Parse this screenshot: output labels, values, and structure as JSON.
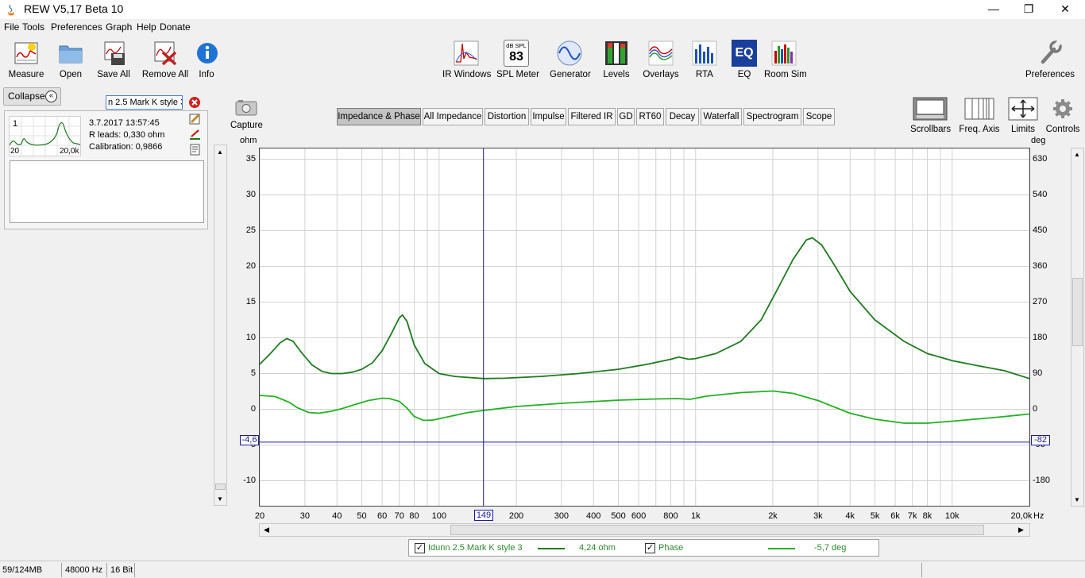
{
  "window": {
    "title": "REW V5,17 Beta 10",
    "minimize": "—",
    "maximize": "❐",
    "close": "✕"
  },
  "menu": [
    "File",
    "Tools",
    "Preferences",
    "Graph",
    "Help",
    "Donate"
  ],
  "toolbar": {
    "measure": "Measure",
    "open": "Open",
    "save_all": "Save All",
    "remove_all": "Remove All",
    "info": "Info",
    "ir_windows": "IR Windows",
    "spl_meter": "SPL Meter",
    "spl_unit": "dB SPL",
    "spl_value": "83",
    "generator": "Generator",
    "levels": "Levels",
    "overlays": "Overlays",
    "rta": "RTA",
    "eq": "EQ",
    "room_sim": "Room Sim",
    "preferences": "Preferences"
  },
  "left_panel": {
    "collapse_label": "Collapse",
    "measurement_name": "n 2.5 Mark K style 3",
    "index": "1",
    "thumb_xmin": "20",
    "thumb_xmax": "20,0k",
    "date": "3.7.2017 13:57:45",
    "r_leads": "R leads: 0,330 ohm",
    "calibration": "Calibration: 0,9866"
  },
  "graph_tabs": [
    "Impedance & Phase",
    "All Impedance",
    "Distortion",
    "Impulse",
    "Filtered IR",
    "GD",
    "RT60",
    "Decay",
    "Waterfall",
    "Spectrogram",
    "Scope"
  ],
  "active_tab": "Impedance & Phase",
  "capture_label": "Capture",
  "right_tools": {
    "scrollbars": "Scrollbars",
    "freq_axis": "Freq. Axis",
    "limits": "Limits",
    "controls": "Controls"
  },
  "colors": {
    "impedance": "#1e7a1e",
    "phase": "#22b022",
    "cursor": "#1a1aa0",
    "grid": "#d2d2d2"
  },
  "cursor": {
    "freq_label": "149",
    "left_value": "-4,6",
    "right_value": "-82"
  },
  "legend": {
    "series1_name": "Idunn 2.5 Mark K style 3",
    "series1_value": "4,24 ohm",
    "series2_name": "Phase",
    "series2_value": "-5,7 deg"
  },
  "status": {
    "memory": "59/124MB",
    "rate": "48000 Hz",
    "bits": "16 Bit"
  },
  "chart_data": {
    "type": "line",
    "ylabel": "ohm",
    "y2label": "deg",
    "xlabel": "Hz",
    "xscale": "log",
    "xlim": [
      20,
      20000
    ],
    "ylim": [
      -13.5,
      36.5
    ],
    "y2lim": [
      -243,
      657
    ],
    "y_ticks": [
      35,
      30,
      25,
      20,
      15,
      10,
      5,
      0,
      -5,
      -10
    ],
    "y2_ticks": [
      630,
      540,
      450,
      360,
      270,
      180,
      90,
      0,
      -90,
      -180
    ],
    "x_ticks": [
      {
        "v": 20,
        "l": "20"
      },
      {
        "v": 30,
        "l": "30"
      },
      {
        "v": 40,
        "l": "40"
      },
      {
        "v": 50,
        "l": "50"
      },
      {
        "v": 60,
        "l": "60"
      },
      {
        "v": 70,
        "l": "70"
      },
      {
        "v": 80,
        "l": "80"
      },
      {
        "v": 100,
        "l": "100"
      },
      {
        "v": 200,
        "l": "200"
      },
      {
        "v": 300,
        "l": "300"
      },
      {
        "v": 400,
        "l": "400"
      },
      {
        "v": 500,
        "l": "500"
      },
      {
        "v": 600,
        "l": "600"
      },
      {
        "v": 800,
        "l": "800"
      },
      {
        "v": 1000,
        "l": "1k"
      },
      {
        "v": 2000,
        "l": "2k"
      },
      {
        "v": 3000,
        "l": "3k"
      },
      {
        "v": 4000,
        "l": "4k"
      },
      {
        "v": 5000,
        "l": "5k"
      },
      {
        "v": 6000,
        "l": "6k"
      },
      {
        "v": 7000,
        "l": "7k"
      },
      {
        "v": 8000,
        "l": "8k"
      },
      {
        "v": 10000,
        "l": "10k"
      },
      {
        "v": 20000,
        "l": "20,0k"
      }
    ],
    "cursor_x": 149,
    "cursor_y": -4.6,
    "series": [
      {
        "name": "Idunn 2.5 Mark K style 3",
        "axis": "left",
        "points": [
          [
            20,
            6.3
          ],
          [
            22,
            7.8
          ],
          [
            24,
            9.3
          ],
          [
            25.5,
            9.9
          ],
          [
            27,
            9.5
          ],
          [
            29,
            8.0
          ],
          [
            32,
            6.2
          ],
          [
            35,
            5.3
          ],
          [
            38,
            5.0
          ],
          [
            42,
            5.0
          ],
          [
            46,
            5.2
          ],
          [
            50,
            5.6
          ],
          [
            55,
            6.5
          ],
          [
            60,
            8.2
          ],
          [
            65,
            10.5
          ],
          [
            70,
            12.8
          ],
          [
            72,
            13.2
          ],
          [
            75,
            12.3
          ],
          [
            80,
            9.0
          ],
          [
            88,
            6.4
          ],
          [
            100,
            5.0
          ],
          [
            115,
            4.6
          ],
          [
            130,
            4.45
          ],
          [
            149,
            4.3
          ],
          [
            180,
            4.35
          ],
          [
            250,
            4.6
          ],
          [
            350,
            5.0
          ],
          [
            500,
            5.6
          ],
          [
            650,
            6.3
          ],
          [
            800,
            7.0
          ],
          [
            860,
            7.3
          ],
          [
            940,
            7.0
          ],
          [
            1000,
            7.1
          ],
          [
            1200,
            7.8
          ],
          [
            1500,
            9.5
          ],
          [
            1800,
            12.5
          ],
          [
            2100,
            17.0
          ],
          [
            2400,
            21.0
          ],
          [
            2700,
            23.7
          ],
          [
            2850,
            24.0
          ],
          [
            3100,
            23.0
          ],
          [
            3500,
            20.0
          ],
          [
            4000,
            16.5
          ],
          [
            5000,
            12.5
          ],
          [
            6500,
            9.5
          ],
          [
            8000,
            7.8
          ],
          [
            10000,
            6.8
          ],
          [
            13000,
            6.0
          ],
          [
            16000,
            5.4
          ],
          [
            20000,
            4.3
          ]
        ]
      },
      {
        "name": "Phase",
        "axis": "right",
        "points": [
          [
            20,
            35
          ],
          [
            23,
            32
          ],
          [
            26,
            18
          ],
          [
            28,
            4
          ],
          [
            31,
            -8
          ],
          [
            34,
            -10
          ],
          [
            38,
            -5
          ],
          [
            42,
            2
          ],
          [
            47,
            12
          ],
          [
            53,
            22
          ],
          [
            60,
            28
          ],
          [
            64,
            27
          ],
          [
            70,
            20
          ],
          [
            75,
            3
          ],
          [
            80,
            -18
          ],
          [
            87,
            -28
          ],
          [
            95,
            -27
          ],
          [
            110,
            -18
          ],
          [
            130,
            -8
          ],
          [
            149,
            -3
          ],
          [
            200,
            7
          ],
          [
            300,
            15
          ],
          [
            500,
            23
          ],
          [
            700,
            26
          ],
          [
            850,
            27
          ],
          [
            950,
            25
          ],
          [
            1100,
            33
          ],
          [
            1500,
            42
          ],
          [
            2000,
            46
          ],
          [
            2400,
            40
          ],
          [
            3000,
            22
          ],
          [
            4000,
            -10
          ],
          [
            5000,
            -25
          ],
          [
            6500,
            -35
          ],
          [
            8000,
            -35
          ],
          [
            10000,
            -30
          ],
          [
            15000,
            -20
          ],
          [
            20000,
            -12
          ]
        ]
      }
    ]
  }
}
